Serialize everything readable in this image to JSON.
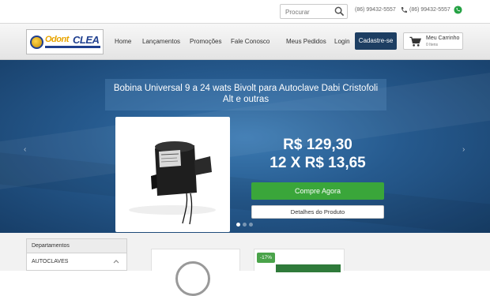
{
  "topbar": {
    "search_placeholder": "Procurar",
    "phone_1": "(86) 99432-5557",
    "phone_2": "(86) 99432-5557"
  },
  "logo": {
    "part1": "Odont",
    "part2": "CLEA"
  },
  "nav": {
    "items": [
      "Home",
      "Lançamentos",
      "Promoções",
      "Fale Conosco",
      "Meus Pedidos",
      "Login"
    ],
    "signup": "Cadastre-se",
    "cart_title": "Meu Carrinho",
    "cart_sub": "0 Itens"
  },
  "hero": {
    "title": "Bobina Universal 9 a 24 wats Bivolt para Autoclave Dabi Cristofoli Alt e outras",
    "price": "R$ 129,30",
    "installments": "12 X R$ 13,65",
    "buy_label": "Compre Agora",
    "details_label": "Detalhes do Produto",
    "slides": 3,
    "active_slide": 1,
    "prev_arrow": "‹",
    "next_arrow": "›"
  },
  "sidebar": {
    "header": "Departamentos",
    "items": [
      "AUTOCLAVES"
    ]
  },
  "products": {
    "discount_badge": "-17%"
  },
  "colors": {
    "nav_button": "#1d3e62",
    "buy_button": "#3aa63a",
    "hero_bg": "#265a8e",
    "whatsapp": "#25a244"
  }
}
